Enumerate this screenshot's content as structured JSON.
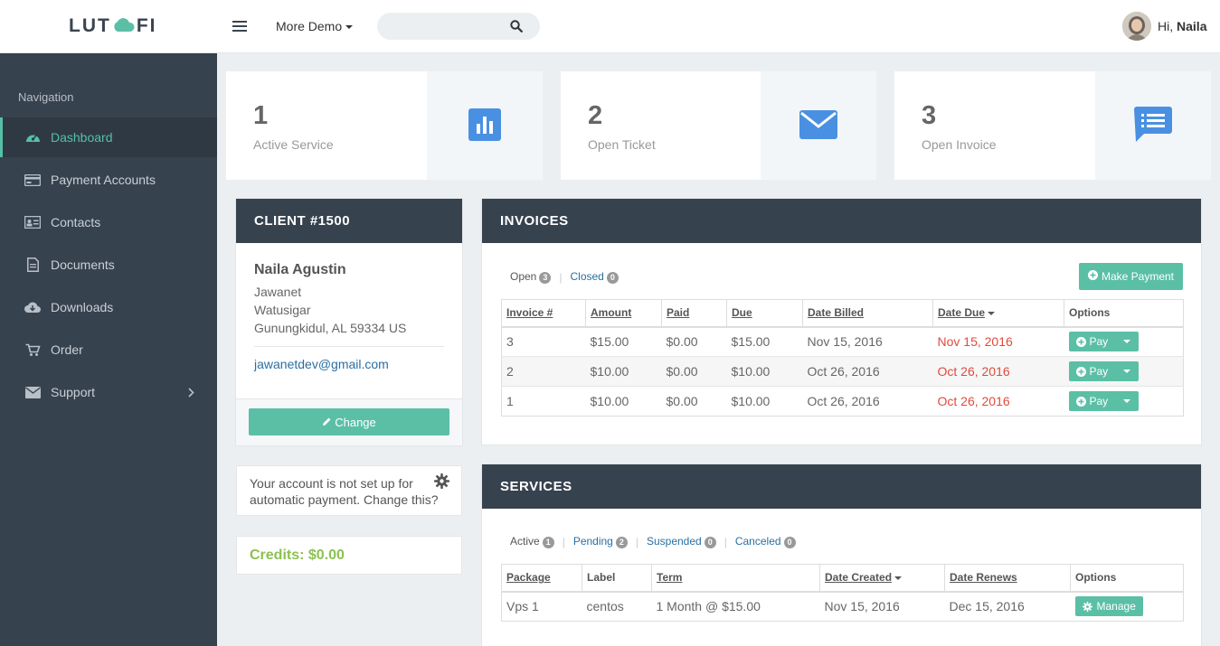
{
  "header": {
    "logo_left": "LUT",
    "logo_right": "FI",
    "more_demo": "More Demo",
    "search_placeholder": "",
    "greeting_prefix": "Hi,",
    "user_name": "Naila"
  },
  "sidebar": {
    "title": "Navigation",
    "items": [
      {
        "label": "Dashboard",
        "icon": "dashboard-icon"
      },
      {
        "label": "Payment Accounts",
        "icon": "credit-card-icon"
      },
      {
        "label": "Contacts",
        "icon": "contact-card-icon"
      },
      {
        "label": "Documents",
        "icon": "document-icon"
      },
      {
        "label": "Downloads",
        "icon": "cloud-download-icon"
      },
      {
        "label": "Order",
        "icon": "cart-icon"
      },
      {
        "label": "Support",
        "icon": "envelope-icon"
      }
    ]
  },
  "stats": [
    {
      "value": "1",
      "label": "Active Service",
      "icon": "bar-chart-icon"
    },
    {
      "value": "2",
      "label": "Open Ticket",
      "icon": "envelope-icon"
    },
    {
      "value": "3",
      "label": "Open Invoice",
      "icon": "chat-list-icon"
    }
  ],
  "client": {
    "title": "CLIENT #1500",
    "name": "Naila Agustin",
    "line1": "Jawanet",
    "line2": "Watusigar",
    "line3": "Gunungkidul, AL 59334 US",
    "email": "jawanetdev@gmail.com",
    "change_label": "Change"
  },
  "notice": {
    "text": "Your account is not set up for automatic payment. Change this?"
  },
  "credits": {
    "text": "Credits: $0.00"
  },
  "invoices": {
    "title": "INVOICES",
    "filters": [
      {
        "label": "Open",
        "count": "3"
      },
      {
        "label": "Closed",
        "count": "0"
      }
    ],
    "make_payment": "Make Payment",
    "columns": [
      "Invoice #",
      "Amount",
      "Paid",
      "Due",
      "Date Billed",
      "Date Due",
      "Options"
    ],
    "rows": [
      {
        "id": "3",
        "amount": "$15.00",
        "paid": "$0.00",
        "due": "$15.00",
        "billed": "Nov 15, 2016",
        "date_due": "Nov 15, 2016",
        "action": "Pay"
      },
      {
        "id": "2",
        "amount": "$10.00",
        "paid": "$0.00",
        "due": "$10.00",
        "billed": "Oct 26, 2016",
        "date_due": "Oct 26, 2016",
        "action": "Pay"
      },
      {
        "id": "1",
        "amount": "$10.00",
        "paid": "$0.00",
        "due": "$10.00",
        "billed": "Oct 26, 2016",
        "date_due": "Oct 26, 2016",
        "action": "Pay"
      }
    ]
  },
  "services": {
    "title": "SERVICES",
    "filters": [
      {
        "label": "Active",
        "count": "1"
      },
      {
        "label": "Pending",
        "count": "2"
      },
      {
        "label": "Suspended",
        "count": "0"
      },
      {
        "label": "Canceled",
        "count": "0"
      }
    ],
    "columns": [
      "Package",
      "Label",
      "Term",
      "Date Created",
      "Date Renews",
      "Options"
    ],
    "rows": [
      {
        "package": "Vps 1",
        "label": "centos",
        "term": "1 Month @ $15.00",
        "created": "Nov 15, 2016",
        "renews": "Dec 15, 2016",
        "action": "Manage"
      }
    ]
  },
  "colors": {
    "accent": "#5bbfa6",
    "sidebar": "#37424f",
    "icon_blue": "#4a90e2",
    "due_red": "#e04b3b",
    "credits_green": "#8cc152"
  }
}
